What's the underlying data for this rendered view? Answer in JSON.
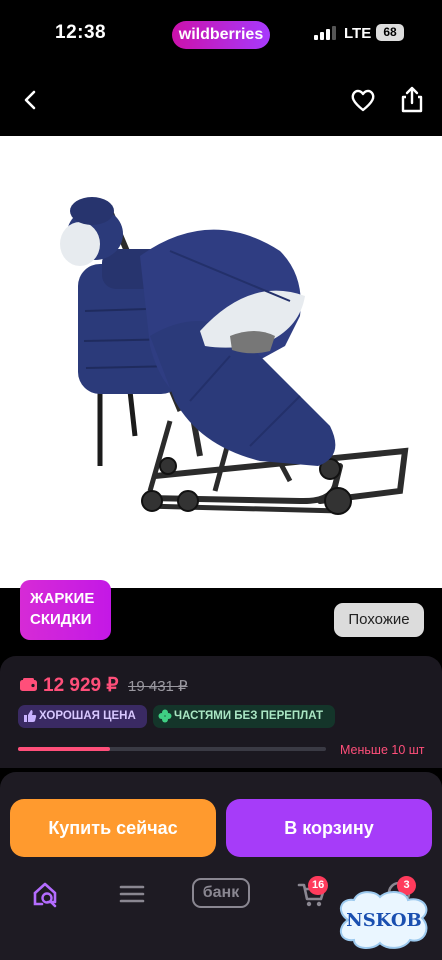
{
  "status_bar": {
    "time": "12:38",
    "brand_pill": "wildberries",
    "network": "LTE",
    "battery": "68"
  },
  "nav": {
    "back_icon": "chevron-left-icon",
    "favorite_icon": "heart-icon",
    "share_icon": "share-icon"
  },
  "product": {
    "image_alt": "sled-stroller-navy"
  },
  "promo": {
    "hot_line1": "ЖАРКИЕ",
    "hot_line2": "СКИДКИ",
    "similar_label": "Похожие"
  },
  "pricing": {
    "price": "12 929 ₽",
    "old_price": "19 431 ₽",
    "chips": [
      {
        "label": "ХОРОШАЯ ЦЕНА",
        "icon": "thumbs-up-icon"
      },
      {
        "label": "ЧАСТЯМИ БЕЗ ПЕРЕПЛАТ",
        "icon": "clover-icon"
      }
    ],
    "stock_fraction": 0.3,
    "stock_text": "Меньше 10 шт"
  },
  "actions": {
    "buy_now": "Купить сейчас",
    "add_to_cart": "В корзину"
  },
  "tab_bar": {
    "items": [
      {
        "icon": "home-search-icon",
        "active": true
      },
      {
        "icon": "menu-icon"
      },
      {
        "label": "банк"
      },
      {
        "icon": "cart-icon",
        "badge": "16"
      },
      {
        "icon": "chat-icon",
        "badge": "3"
      }
    ]
  },
  "watermark": {
    "text": "NSKOB"
  },
  "colors": {
    "brand_gradient_start": "#cb11ab",
    "brand_gradient_end": "#a73afd",
    "price": "#ff4f7a",
    "buy_now": "#ff9a2e",
    "add_to_cart": "#a63cf9"
  }
}
